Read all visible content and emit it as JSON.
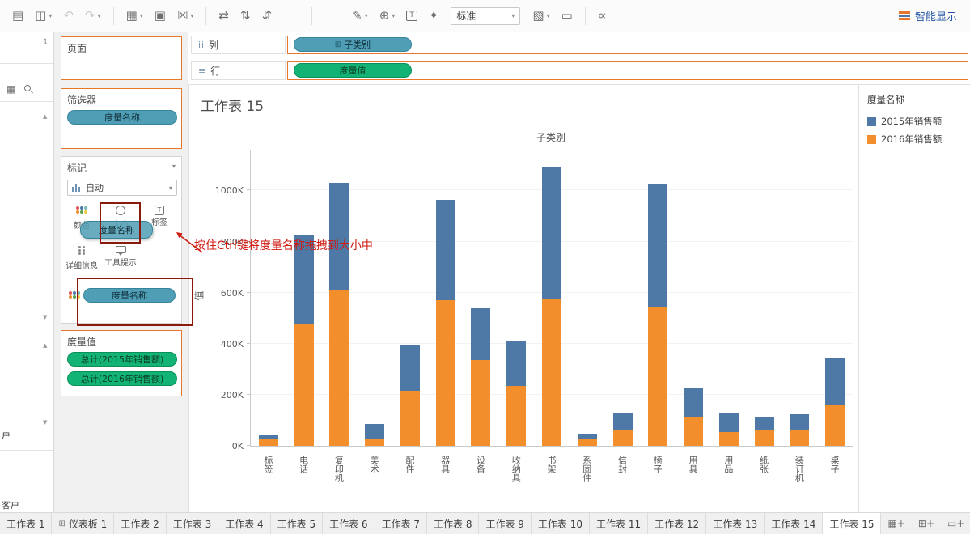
{
  "toolbar": {
    "caret": "▾",
    "fit_mode": "标准",
    "show_me_label": "智能显示",
    "buttons": [
      {
        "name": "add-data-source-icon",
        "glyph": "▤"
      },
      {
        "name": "save-icon",
        "glyph": "◫",
        "dropdown": true
      },
      {
        "name": "undo-icon",
        "glyph": "↶",
        "disabled": true
      },
      {
        "name": "redo-icon",
        "glyph": "↷",
        "disabled": true,
        "dropdown": true
      },
      {
        "sep": true
      },
      {
        "name": "new-worksheet-icon",
        "glyph": "▦",
        "dropdown": true
      },
      {
        "name": "duplicate-sheet-icon",
        "glyph": "▣"
      },
      {
        "name": "clear-sheet-icon",
        "glyph": "☒",
        "dropdown": true
      },
      {
        "sep": true
      },
      {
        "name": "swap-axes-icon",
        "glyph": "⇄"
      },
      {
        "name": "sort-ascending-icon",
        "glyph": "⇅"
      },
      {
        "name": "sort-descending-icon",
        "glyph": "⇵"
      },
      {
        "sep": true,
        "wide": true
      },
      {
        "name": "highlight-icon",
        "glyph": "✎",
        "dropdown": true
      },
      {
        "name": "group-icon",
        "glyph": "⊕",
        "dropdown": true
      },
      {
        "name": "show-mark-labels-icon",
        "glyph": "T",
        "boxed": true
      },
      {
        "name": "fix-axes-icon",
        "glyph": "✦"
      },
      {
        "fit": true
      },
      {
        "name": "show-cards-icon",
        "glyph": "▧",
        "dropdown": true
      },
      {
        "name": "presentation-mode-icon",
        "glyph": "▭"
      },
      {
        "sep": true
      },
      {
        "name": "share-icon",
        "glyph": "∝"
      }
    ]
  },
  "data_pane": {
    "expand_glyph": "⇕",
    "grid_glyph": "▦",
    "scroll_up_glyph": "▲",
    "scroll_down_glyph": "▼",
    "items": [
      "户",
      "客户"
    ]
  },
  "cards": {
    "pages": {
      "title": "页面"
    },
    "filters": {
      "title": "筛选器",
      "pills": [
        {
          "label": "度量名称"
        }
      ]
    },
    "marks": {
      "title": "标记",
      "menu_glyph": "▾",
      "mark_type": "自动",
      "buttons": [
        {
          "label": "颜色"
        },
        {
          "label": "大小"
        },
        {
          "label": "标签"
        },
        {
          "label": "详细信息"
        },
        {
          "label": "工具提示"
        }
      ],
      "color_pill": {
        "label": "度量名称"
      },
      "drag_pill": {
        "label": "度量名称"
      }
    },
    "measure_values": {
      "title": "度量值",
      "pills": [
        {
          "label": "总计(2015年销售额)"
        },
        {
          "label": "总计(2016年销售额)"
        }
      ]
    }
  },
  "shelves": {
    "columns": {
      "icon": "ⅲ",
      "label": "列",
      "pills": [
        {
          "prefix": "⊞",
          "label": "子类别"
        }
      ]
    },
    "rows": {
      "icon": "≡",
      "label": "行",
      "pills": [
        {
          "label": "度量值"
        }
      ]
    }
  },
  "sheet": {
    "title": "工作表 15"
  },
  "annotation": {
    "text": "按住Ctrl键将度量名称拖拽到大小中"
  },
  "chart_data": {
    "type": "bar",
    "stacked": true,
    "title": "子类别",
    "xlabel": "子类别",
    "ylabel": "值",
    "units": "K (thousands)",
    "grid": true,
    "legend_position": "right",
    "categories": [
      "标签",
      "电话",
      "复印机",
      "美术",
      "配件",
      "器具",
      "设备",
      "收纳具",
      "书架",
      "系固件",
      "信封",
      "椅子",
      "用具",
      "用品",
      "纸张",
      "装订机",
      "桌子"
    ],
    "series": [
      {
        "name": "2016年销售额",
        "color": "#f28e2b",
        "values": [
          25,
          480,
          610,
          30,
          215,
          570,
          335,
          235,
          575,
          25,
          65,
          545,
          110,
          55,
          60,
          65,
          160
        ]
      },
      {
        "name": "2015年销售额",
        "color": "#4e79a7",
        "values": [
          15,
          345,
          420,
          55,
          180,
          395,
          205,
          175,
          520,
          20,
          65,
          480,
          115,
          75,
          55,
          60,
          185
        ]
      }
    ],
    "yticks": [
      "0K",
      "200K",
      "400K",
      "600K",
      "800K",
      "1000K"
    ],
    "ytick_values": [
      0,
      200,
      400,
      600,
      800,
      1000
    ],
    "ymax_k": 1160
  },
  "legend": {
    "title": "度量名称",
    "items": [
      {
        "label": "2015年销售额",
        "color": "#4e79a7"
      },
      {
        "label": "2016年销售额",
        "color": "#f28e2b"
      }
    ]
  },
  "tabs": {
    "dashboard_glyph": "⊞",
    "active": "工作表 15",
    "items": [
      {
        "label": "工作表 1",
        "kind": "worksheet"
      },
      {
        "label": "仪表板 1",
        "kind": "dashboard"
      },
      {
        "label": "工作表 2",
        "kind": "worksheet"
      },
      {
        "label": "工作表 3",
        "kind": "worksheet"
      },
      {
        "label": "工作表 4",
        "kind": "worksheet"
      },
      {
        "label": "工作表 5",
        "kind": "worksheet"
      },
      {
        "label": "工作表 6",
        "kind": "worksheet"
      },
      {
        "label": "工作表 7",
        "kind": "worksheet"
      },
      {
        "label": "工作表 8",
        "kind": "worksheet"
      },
      {
        "label": "工作表 9",
        "kind": "worksheet"
      },
      {
        "label": "工作表 10",
        "kind": "worksheet"
      },
      {
        "label": "工作表 11",
        "kind": "worksheet"
      },
      {
        "label": "工作表 12",
        "kind": "worksheet"
      },
      {
        "label": "工作表 13",
        "kind": "worksheet"
      },
      {
        "label": "工作表 14",
        "kind": "worksheet"
      },
      {
        "label": "工作表 15",
        "kind": "worksheet"
      }
    ],
    "new_icons": [
      {
        "name": "new-worksheet-tab-icon",
        "glyph": "▦+"
      },
      {
        "name": "new-dashboard-tab-icon",
        "glyph": "⊞+"
      },
      {
        "name": "new-story-tab-icon",
        "glyph": "▭+"
      }
    ]
  }
}
